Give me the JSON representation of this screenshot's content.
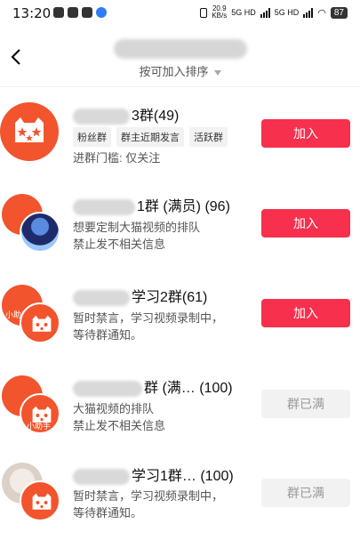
{
  "status_bar": {
    "time": "13:20",
    "speed_top": "20.9",
    "speed_unit": "KB/s",
    "net1": "5G HD",
    "net2": "5G HD",
    "battery": "87"
  },
  "header": {
    "subtitle": "按可加入排序"
  },
  "groups": [
    {
      "name_tail": "3群(49)",
      "tags": [
        "粉丝群",
        "群主近期发言",
        "活跃群"
      ],
      "desc": [
        "进群门槛: 仅关注"
      ],
      "button": "加入",
      "button_state": "join",
      "avatar_badge": ""
    },
    {
      "name_tail": "1群 (满员) (96)",
      "tags": [],
      "desc": [
        "想要定制大猫视频的排队",
        "禁止发不相关信息"
      ],
      "button": "加入",
      "button_state": "join",
      "avatar_badge": ""
    },
    {
      "name_tail": "学习2群(61)",
      "tags": [],
      "desc": [
        "暂时禁言，学习视频录制中，",
        "等待群通知。"
      ],
      "button": "加入",
      "button_state": "join",
      "avatar_badge": "小助手"
    },
    {
      "name_tail": "群 (满… (100)",
      "tags": [],
      "desc": [
        "大猫视频的排队",
        "禁止发不相关信息"
      ],
      "button": "群已满",
      "button_state": "full",
      "avatar_badge": "小助手"
    },
    {
      "name_tail": "学习1群… (100)",
      "tags": [],
      "desc": [
        "暂时禁言，学习视频录制中，",
        "等待群通知。"
      ],
      "button": "群已满",
      "button_state": "full",
      "avatar_badge": ""
    }
  ],
  "colors": {
    "join": "#f6304d",
    "avatar": "#f2542d"
  }
}
